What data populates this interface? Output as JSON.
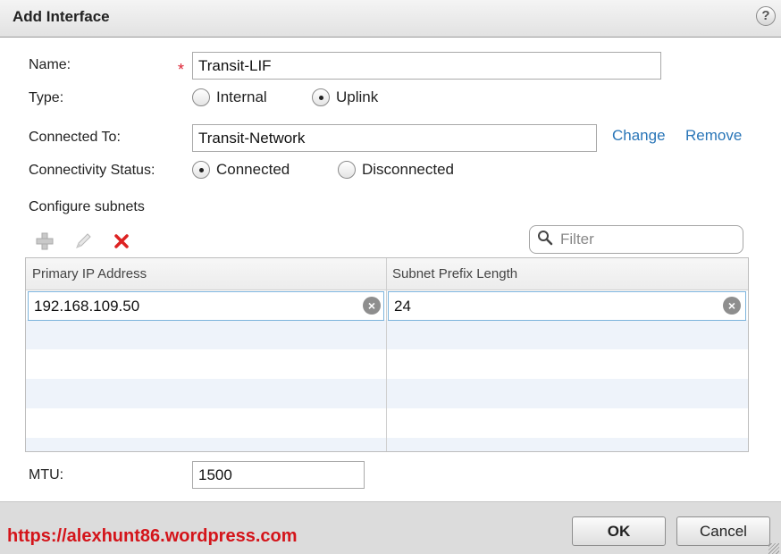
{
  "dialog": {
    "title": "Add Interface"
  },
  "form": {
    "name_label": "Name:",
    "required_mark": "*",
    "name_value": "Transit-LIF",
    "type_label": "Type:",
    "type_options": [
      {
        "label": "Internal",
        "selected": false
      },
      {
        "label": "Uplink",
        "selected": true
      }
    ],
    "connected_to_label": "Connected To:",
    "connected_to_value": "Transit-Network",
    "change_link": "Change",
    "remove_link": "Remove",
    "connectivity_label": "Connectivity Status:",
    "connectivity_options": [
      {
        "label": "Connected",
        "selected": true
      },
      {
        "label": "Disconnected",
        "selected": false
      }
    ],
    "subnets_label": "Configure subnets",
    "filter_placeholder": "Filter",
    "mtu_label": "MTU:",
    "mtu_value": "1500"
  },
  "subnets_table": {
    "columns": [
      "Primary IP Address",
      "Subnet Prefix Length"
    ],
    "rows": [
      {
        "ip": "192.168.109.50",
        "prefix": "24"
      }
    ]
  },
  "footer": {
    "watermark": "https://alexhunt86.wordpress.com",
    "ok_label": "OK",
    "cancel_label": "Cancel"
  },
  "icons": {
    "help": "help-icon",
    "add": "add-icon",
    "edit": "edit-pencil-icon",
    "delete": "delete-x-icon",
    "search": "search-icon",
    "clear": "clear-icon"
  },
  "colors": {
    "link": "#2a76b8",
    "required": "#d23",
    "delete": "#d22",
    "watermark": "#d4141a",
    "focus_border": "#7cb4dc"
  }
}
